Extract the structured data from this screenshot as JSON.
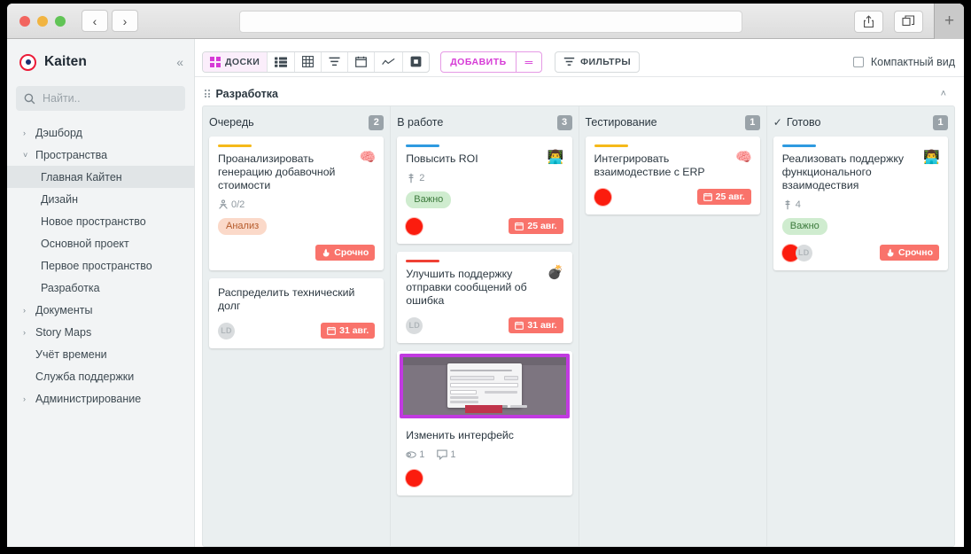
{
  "browser": {
    "back_label": "‹",
    "forward_label": "›",
    "url_value": "",
    "url_placeholder": "",
    "share_icon": "share-icon",
    "tabs_icon": "tabs-icon",
    "newtab_label": "+"
  },
  "sidebar": {
    "brand": "Kaiten",
    "collapse_label": "«",
    "search_placeholder": "Найти..",
    "items": [
      {
        "label": "Дэшборд",
        "chevron": "›",
        "sub": false,
        "active": false
      },
      {
        "label": "Пространства",
        "chevron": "˅",
        "sub": false,
        "active": false
      },
      {
        "label": "Главная Кайтен",
        "chevron": "",
        "sub": true,
        "active": true
      },
      {
        "label": "Дизайн",
        "chevron": "",
        "sub": true,
        "active": false
      },
      {
        "label": "Новое пространство",
        "chevron": "",
        "sub": true,
        "active": false
      },
      {
        "label": "Основной проект",
        "chevron": "",
        "sub": true,
        "active": false
      },
      {
        "label": "Первое пространство",
        "chevron": "",
        "sub": true,
        "active": false
      },
      {
        "label": "Разработка",
        "chevron": "",
        "sub": true,
        "active": false
      },
      {
        "label": "Документы",
        "chevron": "›",
        "sub": false,
        "active": false
      },
      {
        "label": "Story Maps",
        "chevron": "›",
        "sub": false,
        "active": false
      },
      {
        "label": "Учёт времени",
        "chevron": "",
        "sub": false,
        "active": false
      },
      {
        "label": "Служба поддержки",
        "chevron": "",
        "sub": false,
        "active": false
      },
      {
        "label": "Администрирование",
        "chevron": "›",
        "sub": false,
        "active": false
      }
    ]
  },
  "toolbar": {
    "boards_label": "ДОСКИ",
    "add_label": "ДОБАВИТЬ",
    "add_menu_label": "═",
    "filters_label": "ФИЛЬТРЫ",
    "compact_label": "Компактный вид",
    "accent_color": "#d63ad6",
    "view_icons": [
      "grid-view-icon",
      "list-view-icon",
      "table-view-icon",
      "swimlane-view-icon",
      "calendar-view-icon",
      "chart-view-icon",
      "timeline-view-icon"
    ]
  },
  "board": {
    "title": "Разработка",
    "collapse_chevron": "˄",
    "columns": [
      {
        "name": "Очередь",
        "count": "2",
        "done": false,
        "cards": [
          {
            "bar_color": "#f5b91a",
            "title": "Проанализировать генерацию добавочной стоимости",
            "emoji": "🧠",
            "emoji_name": "brain-emoji",
            "meta": [
              {
                "icon": "checklist-icon",
                "text": "0/2"
              }
            ],
            "tag": {
              "text": "Анализ",
              "style": "orange"
            },
            "members": [],
            "badge": {
              "text": "Срочно",
              "icon": "fire-icon"
            }
          },
          {
            "bar_color": "",
            "title": "Распределить технический долг",
            "emoji": "",
            "emoji_name": "",
            "meta": [],
            "tag": null,
            "members": [
              {
                "type": "initials",
                "text": "LD"
              }
            ],
            "badge": {
              "text": "31 авг.",
              "icon": "calendar-icon"
            }
          }
        ]
      },
      {
        "name": "В работе",
        "count": "3",
        "done": false,
        "cards": [
          {
            "bar_color": "#2e9ae0",
            "title": "Повысить ROI",
            "emoji": "👨‍💻",
            "emoji_name": "developer-emoji",
            "meta": [
              {
                "icon": "priority-icon",
                "text": "2"
              }
            ],
            "tag": {
              "text": "Важно",
              "style": "green"
            },
            "members": [
              {
                "type": "dot"
              }
            ],
            "badge": {
              "text": "25 авг.",
              "icon": "calendar-icon"
            }
          },
          {
            "bar_color": "#ef4034",
            "title": "Улучшить поддержку отправки сообщений об ошибка",
            "emoji": "💣",
            "emoji_name": "bomb-emoji",
            "meta": [],
            "tag": null,
            "members": [
              {
                "type": "initials",
                "text": "LD"
              }
            ],
            "badge": {
              "text": "31 авг.",
              "icon": "calendar-icon"
            }
          },
          {
            "photo": true,
            "photo_name": "card-cover-screenshot",
            "title": "Изменить интерфейс",
            "emoji": "",
            "emoji_name": "",
            "meta": [
              {
                "icon": "attachment-icon",
                "text": "1"
              },
              {
                "icon": "comment-icon",
                "text": "1"
              }
            ],
            "tag": null,
            "members": [
              {
                "type": "dot"
              }
            ],
            "badge": null
          }
        ]
      },
      {
        "name": "Тестирование",
        "count": "1",
        "done": false,
        "cards": [
          {
            "bar_color": "#f5b91a",
            "title": "Интегрировать взаимодествие с ERP",
            "emoji": "🧠",
            "emoji_name": "brain-emoji",
            "meta": [],
            "tag": null,
            "members": [
              {
                "type": "dot"
              }
            ],
            "badge": {
              "text": "25 авг.",
              "icon": "calendar-icon"
            }
          }
        ]
      },
      {
        "name": "Готово",
        "count": "1",
        "done": true,
        "cards": [
          {
            "bar_color": "#2e9ae0",
            "title": "Реализовать поддержку функционального взаимодествия",
            "emoji": "👨‍💻",
            "emoji_name": "developer-emoji",
            "meta": [
              {
                "icon": "priority-icon",
                "text": "4"
              }
            ],
            "tag": {
              "text": "Важно",
              "style": "green"
            },
            "members": [
              {
                "type": "dot"
              },
              {
                "type": "initials",
                "text": "LD"
              }
            ],
            "badge": {
              "text": "Срочно",
              "icon": "fire-icon"
            }
          }
        ]
      }
    ]
  }
}
